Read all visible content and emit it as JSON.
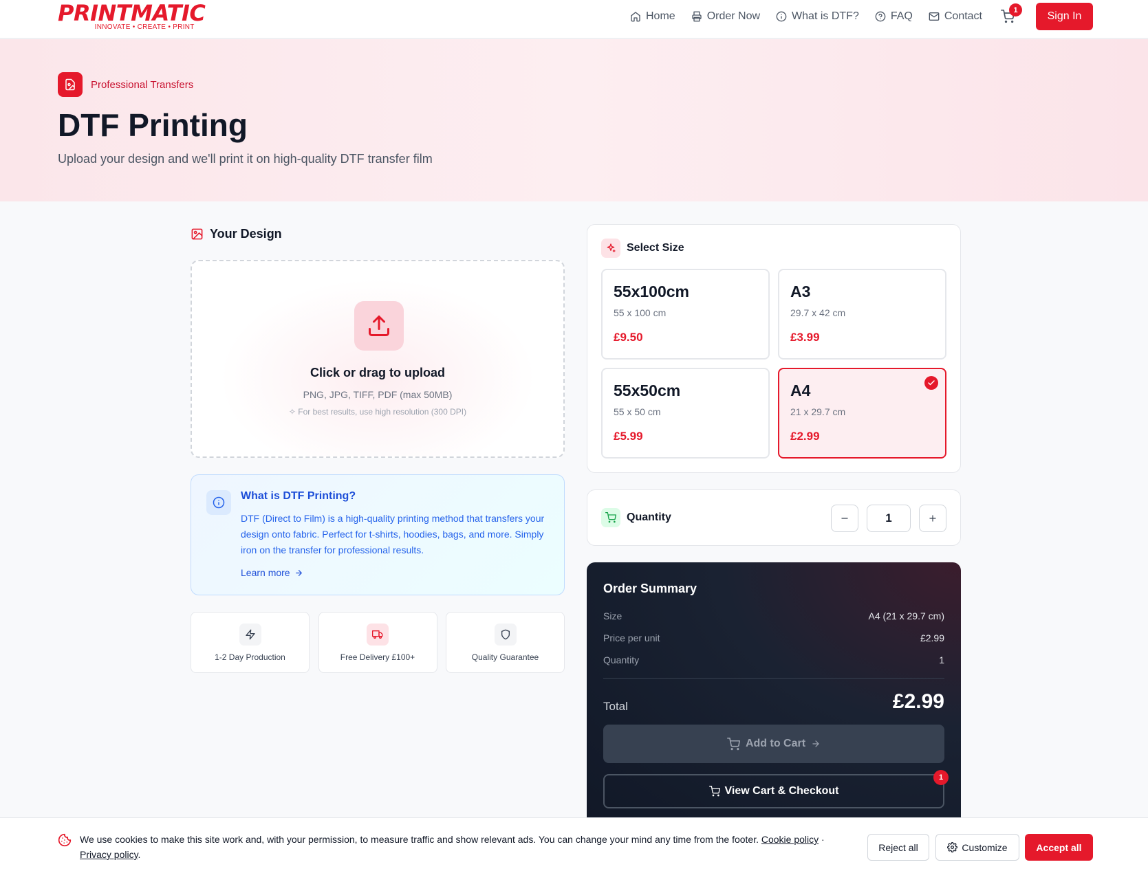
{
  "header": {
    "logo_text": "PRINTMATIC",
    "logo_tagline": "INNOVATE • CREATE • PRINT",
    "nav": [
      {
        "label": "Home",
        "icon": "home-icon"
      },
      {
        "label": "Order Now",
        "icon": "printer-icon"
      },
      {
        "label": "What is DTF?",
        "icon": "info-icon"
      },
      {
        "label": "FAQ",
        "icon": "help-circle-icon"
      },
      {
        "label": "Contact",
        "icon": "mail-icon"
      }
    ],
    "cart_count": "1",
    "signin_label": "Sign In"
  },
  "hero": {
    "chip_label": "Professional Transfers",
    "title": "DTF Printing",
    "subtitle": "Upload your design and we'll print it on high-quality DTF transfer film"
  },
  "design": {
    "title": "Your Design",
    "upload_title": "Click or drag to upload",
    "upload_formats": "PNG, JPG, TIFF, PDF (max 50MB)",
    "upload_hint": "For best results, use high resolution (300 DPI)"
  },
  "info": {
    "title": "What is DTF Printing?",
    "body": "DTF (Direct to Film) is a high-quality printing method that transfers your design onto fabric. Perfect for t-shirts, hoodies, bags, and more. Simply iron on the transfer for professional results.",
    "link": "Learn more"
  },
  "features": [
    {
      "label": "1-2 Day Production",
      "icon": "lightning-icon"
    },
    {
      "label": "Free Delivery £100+",
      "icon": "truck-icon"
    },
    {
      "label": "Quality Guarantee",
      "icon": "shield-icon"
    }
  ],
  "size": {
    "title": "Select Size",
    "options": [
      {
        "name": "55x100cm",
        "dims": "55 x 100 cm",
        "price": "£9.50",
        "selected": false
      },
      {
        "name": "A3",
        "dims": "29.7 x 42 cm",
        "price": "£3.99",
        "selected": false
      },
      {
        "name": "55x50cm",
        "dims": "55 x 50 cm",
        "price": "£5.99",
        "selected": false
      },
      {
        "name": "A4",
        "dims": "21 x 29.7 cm",
        "price": "£2.99",
        "selected": true
      }
    ]
  },
  "quantity": {
    "title": "Quantity",
    "value": "1"
  },
  "summary": {
    "title": "Order Summary",
    "rows": [
      {
        "label": "Size",
        "value": "A4 (21 x 29.7 cm)"
      },
      {
        "label": "Price per unit",
        "value": "£2.99"
      },
      {
        "label": "Quantity",
        "value": "1"
      }
    ],
    "total_label": "Total",
    "total_value": "£2.99",
    "add_to_cart": "Add to Cart",
    "view_cart": "View Cart & Checkout",
    "view_cart_badge": "1"
  },
  "cookie": {
    "text": "We use cookies to make this site work and, with your permission, to measure traffic and show relevant ads. You can change your mind any time from the footer.",
    "cookie_policy": "Cookie policy",
    "separator": "·",
    "privacy_policy": "Privacy policy",
    "reject": "Reject all",
    "customize": "Customize",
    "accept": "Accept all"
  },
  "colors": {
    "brand_red": "#e5192b",
    "dark": "#111827",
    "info_blue": "#2563eb"
  }
}
